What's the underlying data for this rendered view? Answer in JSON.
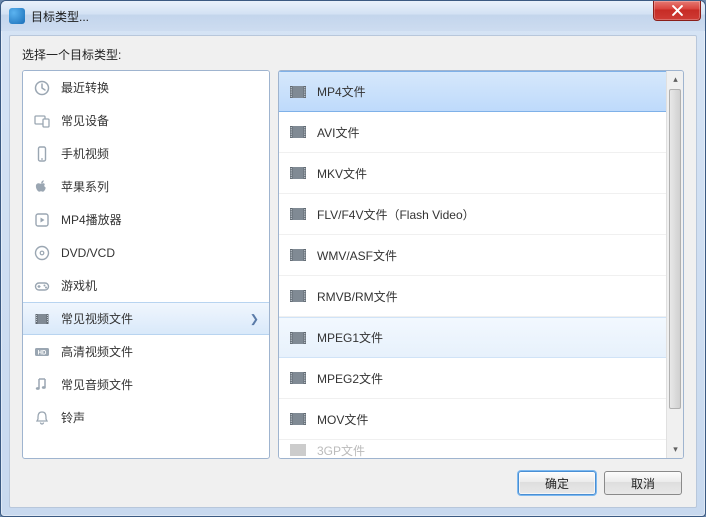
{
  "window": {
    "title": "目标类型...",
    "close_label": "关闭"
  },
  "instruction": "选择一个目标类型:",
  "categories": [
    {
      "label": "最近转换",
      "icon": "clock-icon"
    },
    {
      "label": "常见设备",
      "icon": "devices-icon"
    },
    {
      "label": "手机视频",
      "icon": "phone-icon"
    },
    {
      "label": "苹果系列",
      "icon": "apple-icon"
    },
    {
      "label": "MP4播放器",
      "icon": "player-icon"
    },
    {
      "label": "DVD/VCD",
      "icon": "disc-icon"
    },
    {
      "label": "游戏机",
      "icon": "gamepad-icon"
    },
    {
      "label": "常见视频文件",
      "icon": "video-file-icon",
      "selected": true
    },
    {
      "label": "高清视频文件",
      "icon": "hd-icon"
    },
    {
      "label": "常见音频文件",
      "icon": "audio-icon"
    },
    {
      "label": "铃声",
      "icon": "bell-icon"
    }
  ],
  "formats": [
    {
      "label": "MP4文件",
      "selected": true
    },
    {
      "label": "AVI文件"
    },
    {
      "label": "MKV文件"
    },
    {
      "label": "FLV/F4V文件（Flash Video）"
    },
    {
      "label": "WMV/ASF文件"
    },
    {
      "label": "RMVB/RM文件"
    },
    {
      "label": "MPEG1文件",
      "hover": true
    },
    {
      "label": "MPEG2文件"
    },
    {
      "label": "MOV文件"
    },
    {
      "label": "3GP文件",
      "partial": true
    }
  ],
  "buttons": {
    "ok": "确定",
    "cancel": "取消"
  },
  "colors": {
    "accent": "#7fb1e8",
    "selection_bg": "#bedafb"
  }
}
